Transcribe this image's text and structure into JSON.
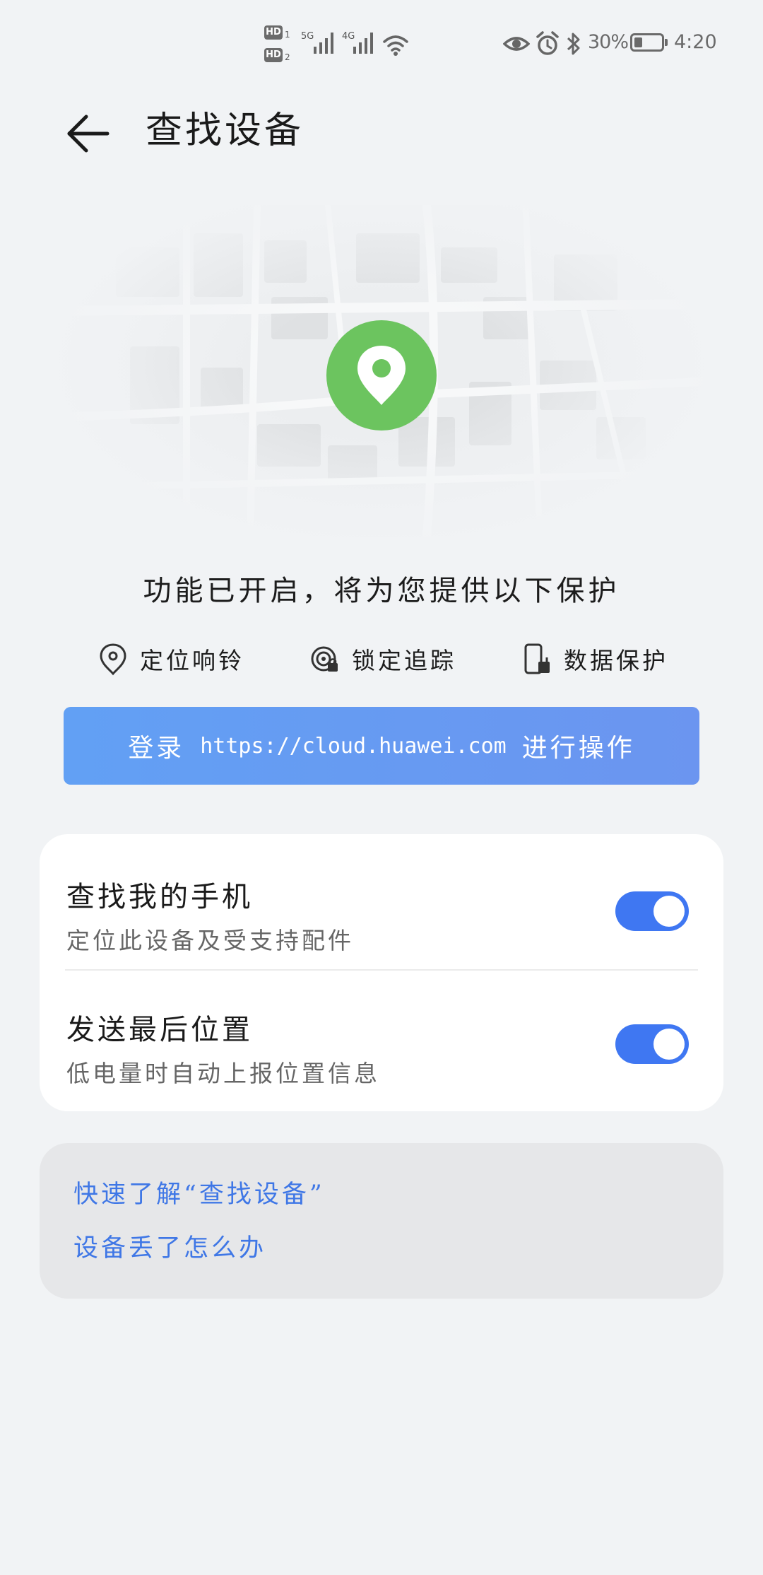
{
  "status_bar": {
    "sim1": "HD",
    "sim1_slot": "1",
    "sim2": "HD",
    "sim2_slot": "2",
    "net1": "5G",
    "net2": "4G",
    "battery_text": "30%",
    "battery_level": 0.3,
    "time": "4:20",
    "icons": [
      "eye-icon",
      "alarm-icon",
      "bluetooth-icon",
      "wifi-icon"
    ]
  },
  "header": {
    "title": "查找设备",
    "back_icon": "back-arrow-icon"
  },
  "hero": {
    "icon": "location-pin-icon",
    "pin_color": "#6cc45f"
  },
  "features": {
    "headline": "功能已开启，将为您提供以下保护",
    "items": [
      {
        "icon": "location-pin-outline-icon",
        "label": "定位响铃"
      },
      {
        "icon": "lock-tracking-icon",
        "label": "锁定追踪"
      },
      {
        "icon": "phone-clean-icon",
        "label": "数据保护"
      }
    ]
  },
  "login_banner": {
    "prefix": "登录",
    "url": "https://cloud.huawei.com",
    "suffix": "进行操作"
  },
  "settings": {
    "items": [
      {
        "title": "查找我的手机",
        "subtitle": "定位此设备及受支持配件",
        "enabled": true
      },
      {
        "title": "发送最后位置",
        "subtitle": "低电量时自动上报位置信息",
        "enabled": true
      }
    ],
    "toggle_color": "#3f77f2"
  },
  "help": {
    "links": [
      "快速了解“查找设备”",
      "设备丢了怎么办"
    ],
    "link_color": "#3f77e6"
  }
}
